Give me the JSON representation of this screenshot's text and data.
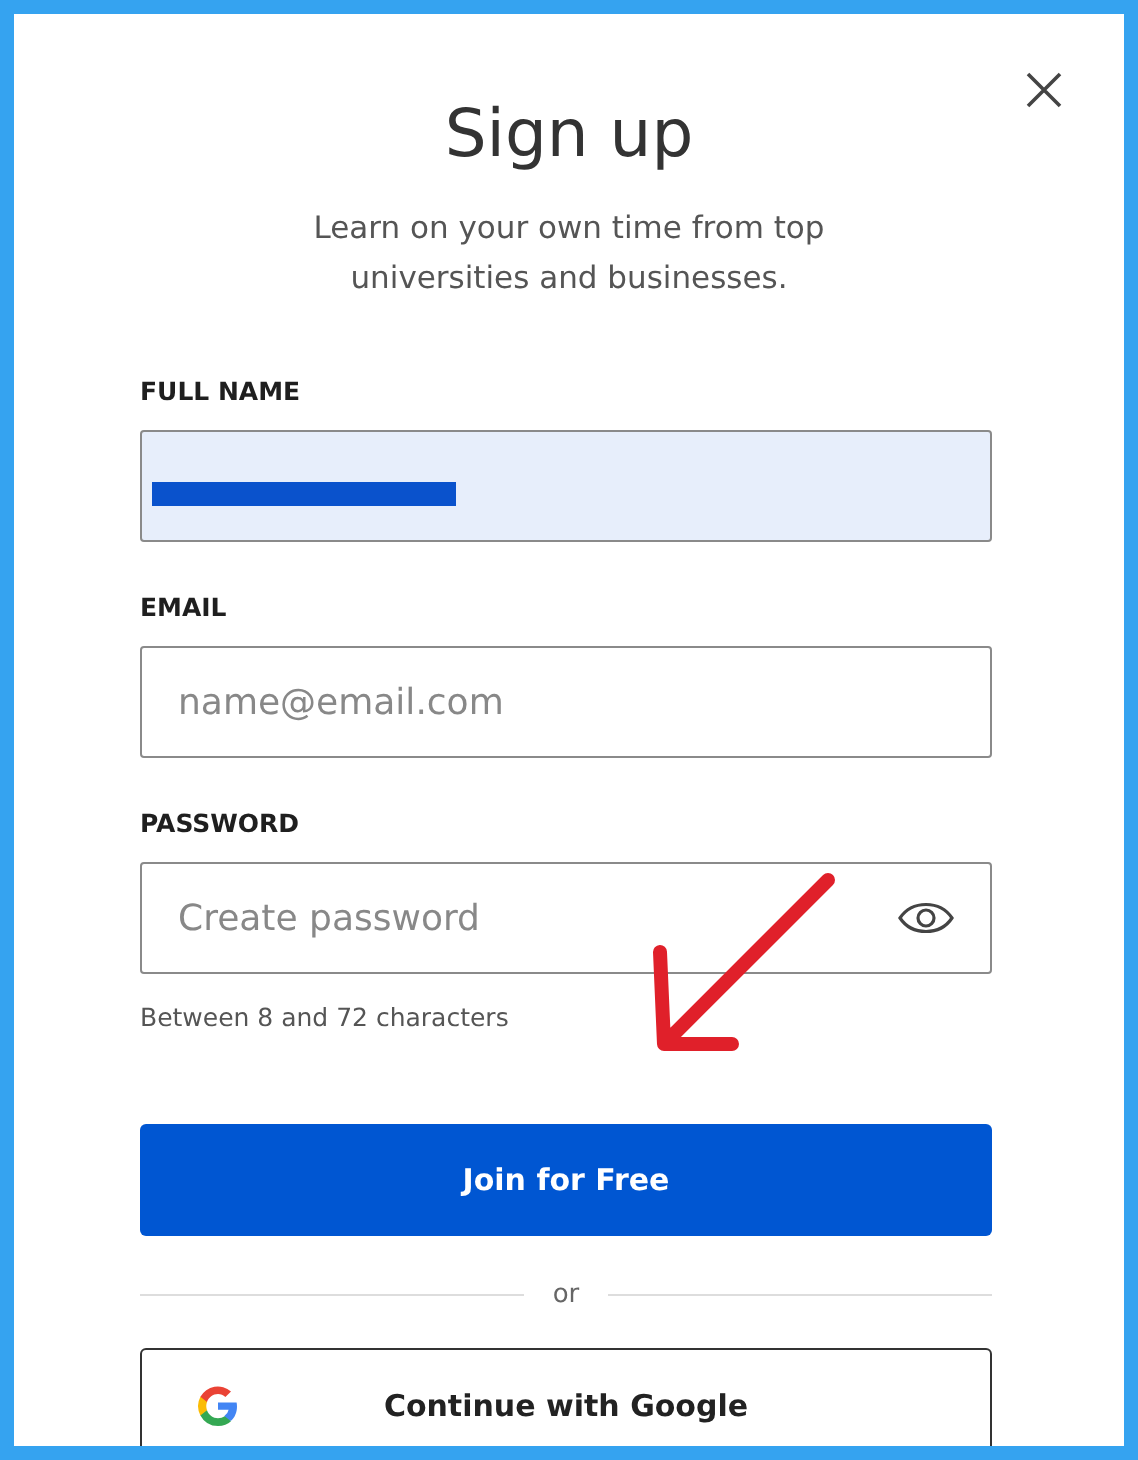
{
  "dialog": {
    "title": "Sign up",
    "subtitle": "Learn on your own time from top universities and businesses."
  },
  "fields": [
    {
      "kind": "autofilled",
      "label": "FULL NAME"
    },
    {
      "kind": "text",
      "label": "EMAIL",
      "placeholder": "name@email.com"
    },
    {
      "kind": "password",
      "label": "PASSWORD",
      "placeholder": "Create password",
      "hint": "Between 8 and 72 characters"
    }
  ],
  "primary_button": "Join for Free",
  "divider": "or",
  "google_button": "Continue with Google"
}
